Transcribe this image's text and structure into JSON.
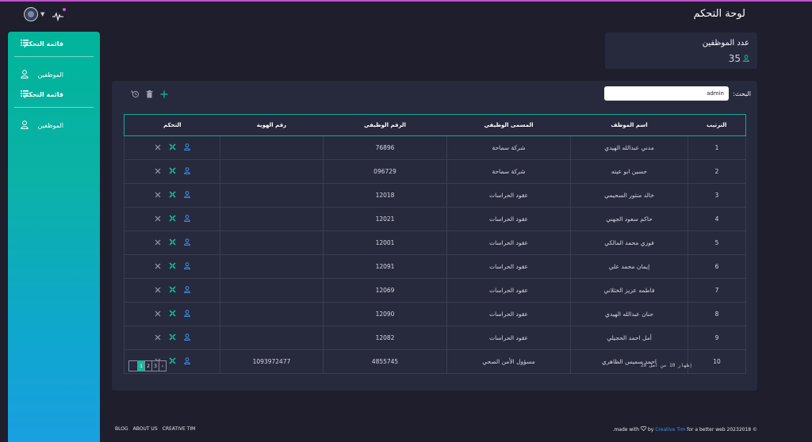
{
  "header": {
    "title": "لوحة التحكم"
  },
  "sidebar": {
    "items": [
      {
        "label": "قائمة التحكم",
        "icon": "list-icon",
        "bold": true
      },
      {
        "label": "الموظفين",
        "icon": "user-icon"
      },
      {
        "label": "قائمة التحكم",
        "icon": "list-icon",
        "bold": true
      },
      {
        "label": "الموظفين",
        "icon": "user-icon"
      }
    ]
  },
  "stats": {
    "title": "عدد الموظفين",
    "value": "35",
    "icon": "user-icon"
  },
  "search": {
    "label": "البحث:",
    "value": "admin"
  },
  "toolbar": {
    "icons": [
      "history-icon",
      "trash-icon",
      "add-icon"
    ]
  },
  "table": {
    "columns": [
      "الترتيب",
      "اسم الموظف",
      "المسمى الوظيفي",
      "الرقم الوظيفي",
      "رقم الهوية",
      "التحكم"
    ],
    "rows": [
      [
        "1",
        "مدني عبدالله الهيدي",
        "شركة سماحة",
        "76896",
        ""
      ],
      [
        "2",
        "حسين ابو عيته",
        "شركة سماحة",
        "096729",
        ""
      ],
      [
        "3",
        "خالد منثور السحيمي",
        "عقود الحراسات",
        "12018",
        ""
      ],
      [
        "4",
        "حاكم سعود الجهني",
        "عقود الحراسات",
        "12021",
        ""
      ],
      [
        "5",
        "فوزي محمد المالكي",
        "عقود الحراسات",
        "12001",
        ""
      ],
      [
        "6",
        "إيمان محمد علي",
        "عقود الحراسات",
        "12091",
        ""
      ],
      [
        "7",
        "فاطمه عزيز الخثلاني",
        "عقود الحراسات",
        "12069",
        ""
      ],
      [
        "8",
        "حنان عبدالله الهيدي",
        "عقود الحراسات",
        "12090",
        ""
      ],
      [
        "9",
        "أمل احمد الحجيلي",
        "عقود الحراسات",
        "12082",
        ""
      ],
      [
        "10",
        "احمد سميس الظاهري",
        "مسؤول الأمن الصحي",
        "4855745",
        "1093972477"
      ]
    ]
  },
  "pagination": {
    "pages": [
      "1",
      "2",
      "3"
    ],
    "active": "1",
    "next": "‹",
    "info": "إظهار 10 من اصل 29"
  },
  "footer": {
    "links": [
      "BLOG",
      "ABOUT US",
      "CREATIVE TIM"
    ],
    "made_with": ".made with",
    "by": "by",
    "brand": "Creative Tim",
    "tail": "for a better web 20232018 ©"
  },
  "colors": {
    "accent": "#1db59a",
    "bg": "#1e1e2c",
    "card": "#27293d",
    "icon_user": "#3f92e8",
    "icon_edit": "#1db59a",
    "icon_delete": "#9a9aa8",
    "notification": "#e14eca"
  }
}
